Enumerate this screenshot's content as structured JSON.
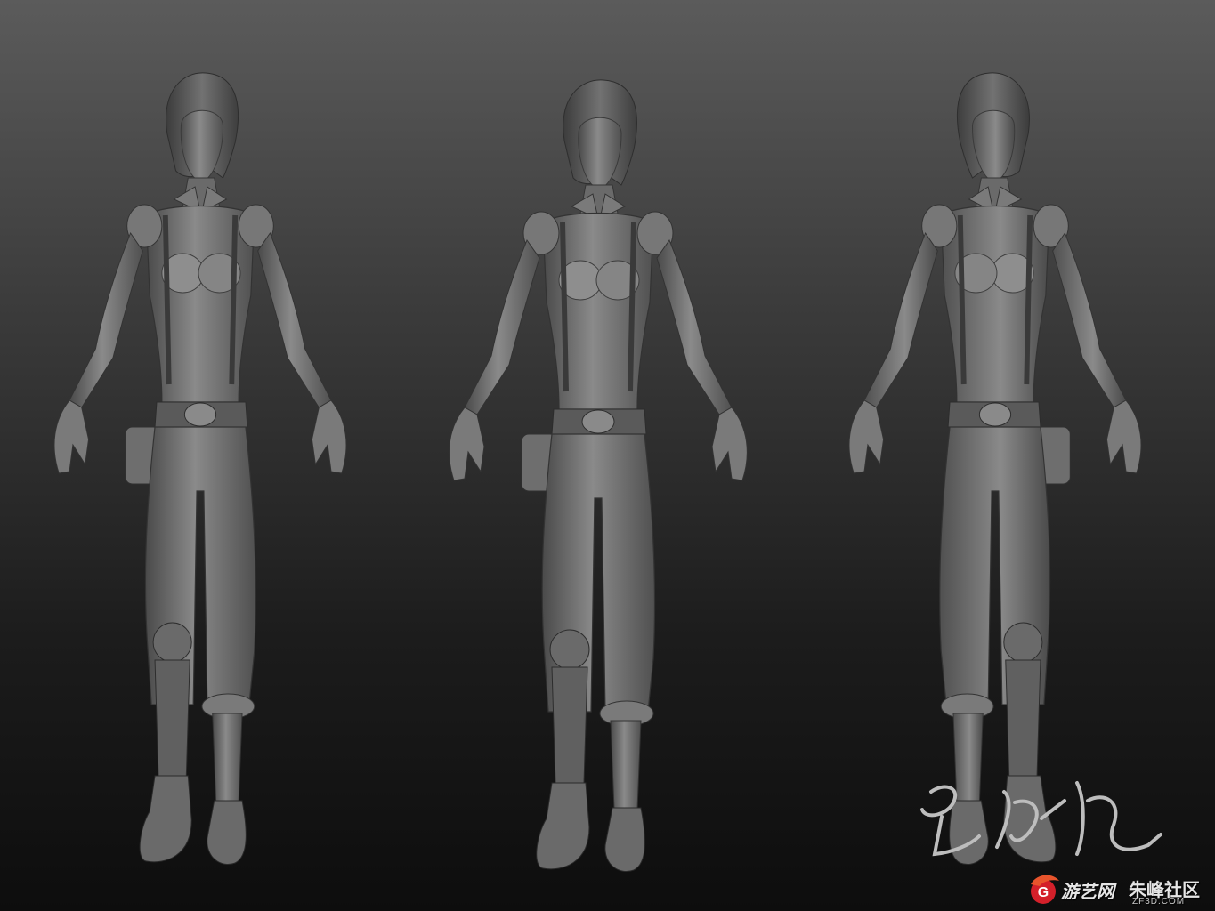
{
  "scene": {
    "description_label": "sculpt-turnaround",
    "views": [
      "three-quarter-left",
      "front",
      "three-quarter-right"
    ]
  },
  "watermark": {
    "site_name": "游艺网",
    "community_name": "朱峰社区",
    "url": "ZF3D.COM",
    "logo_letter": "G",
    "colors": {
      "logo_red": "#d4202a",
      "text": "#e6e6e6"
    }
  }
}
